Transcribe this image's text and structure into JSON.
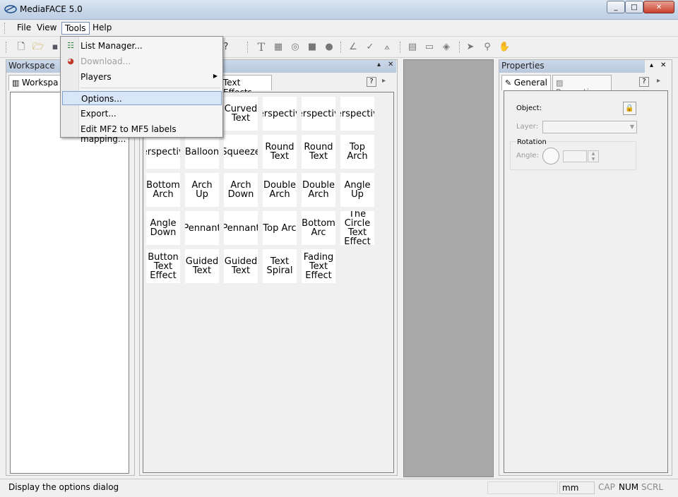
{
  "window": {
    "title": "MediaFACE 5.0",
    "min": "_",
    "max": "□",
    "close": "✕"
  },
  "menubar": {
    "file": "File",
    "view": "View",
    "tools": "Tools",
    "help": "Help"
  },
  "tools_menu": {
    "items": [
      {
        "label": "List Manager...",
        "icon": "list-icon",
        "enabled": true
      },
      {
        "label": "Download...",
        "icon": "globe-icon",
        "enabled": false
      },
      {
        "label": "Players",
        "submenu": true,
        "enabled": true
      },
      {
        "label": "Options...",
        "selected": true,
        "enabled": true
      },
      {
        "label": "Export...",
        "enabled": true
      },
      {
        "label": "Edit MF2 to MF5 labels mapping...",
        "enabled": true
      }
    ]
  },
  "workspace": {
    "header": "Workspace",
    "tab": "Workspa"
  },
  "effects": {
    "tab": "Text Effects",
    "tiles": [
      "Curved Text",
      "Perspective",
      "Perspective",
      "Perspective",
      "Perspective",
      "Balloon",
      "Squeeze",
      "Round Text",
      "Round Text",
      "Top Arch",
      "Bottom Arch",
      "Arch Up",
      "Arch Down",
      "Double Arch",
      "Double Arch",
      "Angle Up",
      "Angle Down",
      "Pennant",
      "Pennant",
      "Top Arc",
      "Bottom Arc",
      "The Circle Text Effect",
      "Button Text Effect",
      "Guided Text",
      "Guided Text",
      "Text Spiral",
      "Fading Text Effect"
    ]
  },
  "properties": {
    "header": "Properties",
    "tab_general": "General",
    "tab_properties": "Properties",
    "object_label": "Object:",
    "layer_label": "Layer:",
    "rotation_label": "Rotation",
    "angle_label": "Angle:"
  },
  "status": {
    "text": "Display the options dialog",
    "unit": "mm",
    "cap": "CAP",
    "num": "NUM",
    "scrl": "SCRL"
  }
}
